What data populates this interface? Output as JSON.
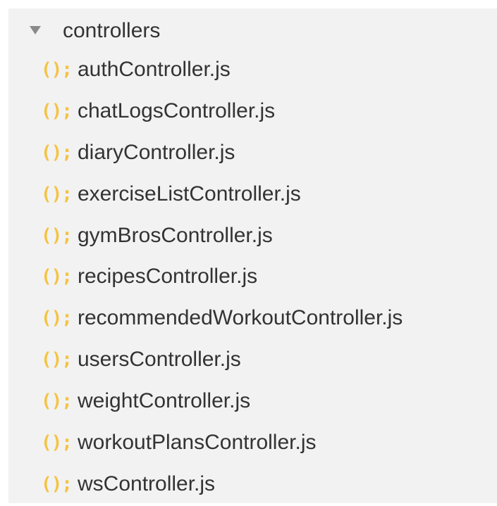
{
  "explorer": {
    "folder": {
      "label": "controllers",
      "icon": "chevron-down-icon",
      "expanded": true
    },
    "file_icon": {
      "glyph": "();",
      "name": "javascript-file-icon",
      "color": "#f5c342"
    },
    "files": [
      {
        "label": "authController.js"
      },
      {
        "label": "chatLogsController.js"
      },
      {
        "label": "diaryController.js"
      },
      {
        "label": "exerciseListController.js"
      },
      {
        "label": "gymBrosController.js"
      },
      {
        "label": "recipesController.js"
      },
      {
        "label": "recommendedWorkoutController.js"
      },
      {
        "label": "usersController.js"
      },
      {
        "label": "weightController.js"
      },
      {
        "label": "workoutPlansController.js"
      },
      {
        "label": "wsController.js"
      }
    ]
  }
}
